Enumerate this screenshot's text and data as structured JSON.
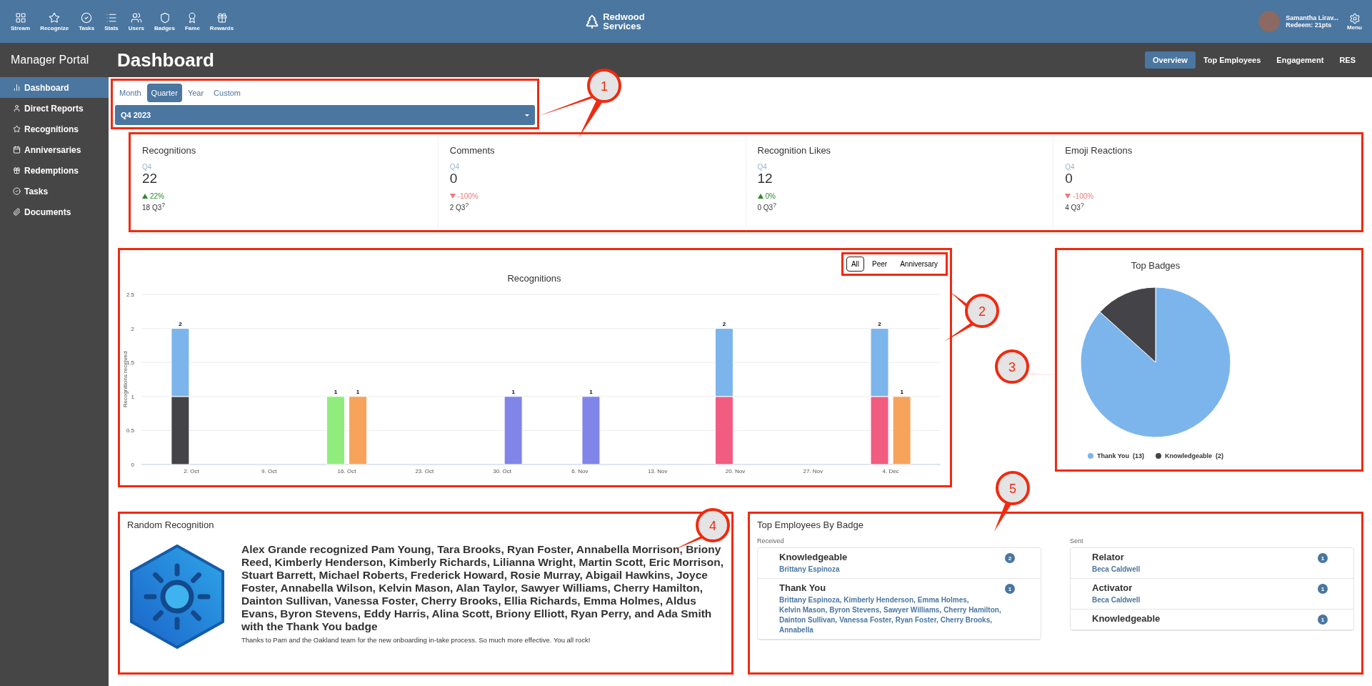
{
  "top_nav": {
    "items": [
      "Stream",
      "Recognize",
      "Tasks",
      "Stats",
      "Users",
      "Badges",
      "Fame",
      "Rewards"
    ],
    "logo_lines": [
      "Redwood",
      "Services"
    ],
    "user": {
      "name": "Samantha Lirav...",
      "points": "Redeem: 21pts"
    },
    "menu": "Menu"
  },
  "sidebar": {
    "title": "Manager Portal",
    "items": [
      {
        "label": "Dashboard",
        "selected": true
      },
      {
        "label": "Direct Reports",
        "selected": false
      },
      {
        "label": "Recognitions",
        "selected": false
      },
      {
        "label": "Anniversaries",
        "selected": false
      },
      {
        "label": "Redemptions",
        "selected": false
      },
      {
        "label": "Tasks",
        "selected": false
      },
      {
        "label": "Documents",
        "selected": false
      }
    ]
  },
  "header": {
    "title": "Dashboard",
    "tabs": [
      {
        "label": "Overview",
        "selected": true
      },
      {
        "label": "Top Employees",
        "selected": false
      },
      {
        "label": "Engagement",
        "selected": false
      },
      {
        "label": "RES",
        "selected": false
      }
    ]
  },
  "period": {
    "tabs": [
      {
        "label": "Month",
        "selected": false
      },
      {
        "label": "Quarter",
        "selected": true
      },
      {
        "label": "Year",
        "selected": false
      },
      {
        "label": "Custom",
        "selected": false
      }
    ],
    "select": {
      "value": "Q4 2023"
    }
  },
  "stats": [
    {
      "title": "Recognitions",
      "period": "Q4",
      "value": "22",
      "rising": true,
      "change": "22%",
      "previous": "18 Q3$^{?}$"
    },
    {
      "title": "Comments",
      "period": "Q4",
      "value": "0",
      "rising": false,
      "change": "-100%",
      "previous": "2 Q3$^{?}$"
    },
    {
      "title": "Recognition Likes",
      "period": "Q4",
      "value": "12",
      "rising": true,
      "change": "0%",
      "previous": "0 Q3$^{?}$"
    },
    {
      "title": "Emoji Reactions",
      "period": "Q4",
      "value": "0",
      "rising": false,
      "change": "-100%",
      "previous": "4 Q3$^{?}$"
    }
  ],
  "recognitions_panel": {
    "filters": [
      {
        "label": "All",
        "selected": true
      },
      {
        "label": "Peer",
        "selected": false
      },
      {
        "label": "Anniversary",
        "selected": false
      }
    ],
    "chart_data": {
      "type": "bar",
      "title": "Recognitions",
      "ylabel": "Recognitions received",
      "stacked": true,
      "grid": true,
      "categories": [
        null,
        null,
        null,
        null,
        "2. Oct",
        null,
        null,
        null,
        null,
        null,
        null,
        "9. Oct",
        null,
        null,
        null,
        null,
        null,
        null,
        "16. Oct",
        null,
        null,
        null,
        null,
        null,
        null,
        "23. Oct",
        null,
        null,
        null,
        null,
        null,
        null,
        "30. Oct",
        null,
        null,
        null,
        null,
        null,
        null,
        "6. Nov",
        null,
        null,
        null,
        null,
        null,
        null,
        "13. Nov",
        null,
        null,
        null,
        null,
        null,
        null,
        "20. Nov",
        null,
        null,
        null,
        null,
        null,
        null,
        "27. Nov",
        null,
        null,
        null,
        null,
        null,
        null,
        "4. Dec",
        null,
        null,
        null,
        null
      ],
      "ylim": [
        0,
        2.5
      ],
      "yticks": [
        0,
        0.5,
        1,
        1.5,
        2,
        2.5
      ],
      "series": [
        {
          "color": "#434348",
          "values": [
            null,
            null,
            null,
            1,
            null,
            null,
            null,
            null,
            null,
            null,
            null,
            null,
            null,
            null,
            null,
            null,
            null,
            null,
            null,
            null,
            null,
            null,
            null,
            null,
            null,
            null,
            null,
            null,
            null,
            null,
            null,
            null,
            null,
            null,
            null,
            null,
            null,
            null,
            null,
            null,
            null,
            null,
            null,
            null,
            null,
            null,
            null,
            null,
            null,
            null,
            null,
            null,
            null,
            null,
            null,
            null,
            null,
            null,
            null,
            null,
            null,
            null,
            null,
            null,
            null,
            null,
            null,
            null,
            null,
            null,
            null,
            null
          ]
        },
        {
          "color": "#f15c80",
          "values": [
            null,
            null,
            null,
            null,
            null,
            null,
            null,
            null,
            null,
            null,
            null,
            null,
            null,
            null,
            null,
            null,
            null,
            null,
            null,
            null,
            null,
            null,
            null,
            null,
            null,
            null,
            null,
            null,
            null,
            null,
            null,
            null,
            null,
            null,
            null,
            null,
            null,
            null,
            null,
            null,
            null,
            null,
            null,
            null,
            null,
            null,
            null,
            null,
            null,
            null,
            null,
            null,
            1,
            null,
            null,
            null,
            null,
            null,
            null,
            null,
            null,
            null,
            null,
            null,
            null,
            null,
            1,
            null,
            null,
            null,
            null,
            null
          ]
        },
        {
          "color": "#7cb5ec",
          "values": [
            null,
            null,
            null,
            1,
            null,
            null,
            null,
            null,
            null,
            null,
            null,
            null,
            null,
            null,
            null,
            null,
            null,
            null,
            null,
            null,
            null,
            null,
            null,
            null,
            null,
            null,
            null,
            null,
            null,
            null,
            null,
            null,
            null,
            null,
            null,
            null,
            null,
            null,
            null,
            null,
            null,
            null,
            null,
            null,
            null,
            null,
            null,
            null,
            null,
            null,
            null,
            null,
            1,
            null,
            null,
            null,
            null,
            null,
            null,
            null,
            null,
            null,
            null,
            null,
            null,
            null,
            1,
            null,
            null,
            null,
            null,
            null
          ]
        },
        {
          "color": "#90ed7d",
          "values": [
            null,
            null,
            null,
            null,
            null,
            null,
            null,
            null,
            null,
            null,
            null,
            null,
            null,
            null,
            null,
            null,
            null,
            1,
            null,
            null,
            null,
            null,
            null,
            null,
            null,
            null,
            null,
            null,
            null,
            null,
            null,
            null,
            null,
            null,
            null,
            null,
            null,
            null,
            null,
            null,
            null,
            null,
            null,
            null,
            null,
            null,
            null,
            null,
            null,
            null,
            null,
            null,
            null,
            null,
            null,
            null,
            null,
            null,
            null,
            null,
            null,
            null,
            null,
            null,
            null,
            null,
            null,
            null,
            null,
            null,
            null,
            null
          ]
        },
        {
          "color": "#f7a35c",
          "values": [
            null,
            null,
            null,
            null,
            null,
            null,
            null,
            null,
            null,
            null,
            null,
            null,
            null,
            null,
            null,
            null,
            null,
            null,
            null,
            1,
            null,
            null,
            null,
            null,
            null,
            null,
            null,
            null,
            null,
            null,
            null,
            null,
            null,
            null,
            null,
            null,
            null,
            null,
            null,
            null,
            null,
            null,
            null,
            null,
            null,
            null,
            null,
            null,
            null,
            null,
            null,
            null,
            null,
            null,
            null,
            null,
            null,
            null,
            null,
            null,
            null,
            null,
            null,
            null,
            null,
            null,
            null,
            null,
            1,
            null,
            null,
            null
          ]
        },
        {
          "color": "#8085e9",
          "values": [
            null,
            null,
            null,
            null,
            null,
            null,
            null,
            null,
            null,
            null,
            null,
            null,
            null,
            null,
            null,
            null,
            null,
            null,
            null,
            null,
            null,
            null,
            null,
            null,
            null,
            null,
            null,
            null,
            null,
            null,
            null,
            null,
            null,
            1,
            null,
            null,
            null,
            null,
            null,
            null,
            1,
            null,
            null,
            null,
            null,
            null,
            null,
            null,
            null,
            null,
            null,
            null,
            null,
            null,
            null,
            null,
            null,
            null,
            null,
            null,
            null,
            null,
            null,
            null,
            null,
            null,
            null,
            null,
            null,
            null,
            null,
            null
          ]
        }
      ],
      "annotations": [
        {
          "y": 2,
          "text": "2"
        },
        {
          "y": 1,
          "text": "1"
        },
        {
          "y": 1,
          "text": "1"
        },
        {
          "y": 1,
          "text": "1"
        },
        {
          "y": 1,
          "text": "1"
        },
        {
          "y": 2,
          "text": "2"
        },
        {
          "y": 2,
          "text": "2"
        },
        {
          "y": 1,
          "text": "1"
        }
      ]
    }
  },
  "top_badges": {
    "chart_data": {
      "type": "pie",
      "title": "Top Badges",
      "categories": [
        "Thank You",
        "Knowledgeable"
      ],
      "values": [
        86.7,
        13.3
      ],
      "colors": [
        "#7cb5ec",
        "#434348"
      ]
    },
    "legend_counts": [
      "(13)",
      "(2)"
    ]
  },
  "random_recognition": {
    "title": "Random Recognition",
    "headline": "Alex Grande recognized Pam Young, Tara Brooks, Ryan Foster, Annabella Morrison, Briony Reed, Kimberly Henderson, Kimberly Richards, Lilianna Wright, Martin Scott, Eric Morrison, Stuart Barrett, Michael Roberts, Frederick Howard, Rosie Murray, Abigail Hawkins, Joyce Foster, Annabella Wilson, Kelvin Mason, Alan Taylor, Sawyer Williams, Cherry Hamilton, Dainton Sullivan, Vanessa Foster, Cherry Brooks, Ellia Richards, Emma Holmes, Aldus Evans, Byron Stevens, Eddy Harris, Alina Scott, Briony Elliott, Ryan Perry, and Ada Smith with the Thank You badge",
    "message": "Thanks to Pam and the Oakland team for the new onboarding in-take process. So much more effective. You all rock!"
  },
  "top_employees": {
    "title": "Top Employees By Badge",
    "columns": [
      {
        "heading": "Received",
        "cards": [
          {
            "badge": "Knowledgeable",
            "count": "2",
            "names": [
              "Brittany Espinoza"
            ]
          },
          {
            "badge": "Thank You",
            "count": "1",
            "names": [
              "Brittany Espinoza,",
              "Kimberly Henderson,",
              "Emma Holmes,",
              "Kelvin Mason,",
              "Byron Stevens,",
              "Sawyer Williams,",
              "Cherry Hamilton,",
              "Dainton Sullivan,",
              "Vanessa Foster,",
              "Ryan Foster,",
              "Cherry Brooks,",
              "Annabella"
            ]
          }
        ]
      },
      {
        "heading": "Sent",
        "cards": [
          {
            "badge": "Relator",
            "count": "1",
            "names": [
              "Beca Caldwell"
            ]
          },
          {
            "badge": "Activator",
            "count": "1",
            "names": [
              "Beca Caldwell"
            ]
          },
          {
            "badge": "Knowledgeable",
            "count": "1"
          }
        ]
      }
    ]
  },
  "annotations": [
    {
      "number": "1"
    },
    {
      "number": "2"
    },
    {
      "number": "3"
    },
    {
      "number": "4"
    },
    {
      "number": "5"
    }
  ]
}
